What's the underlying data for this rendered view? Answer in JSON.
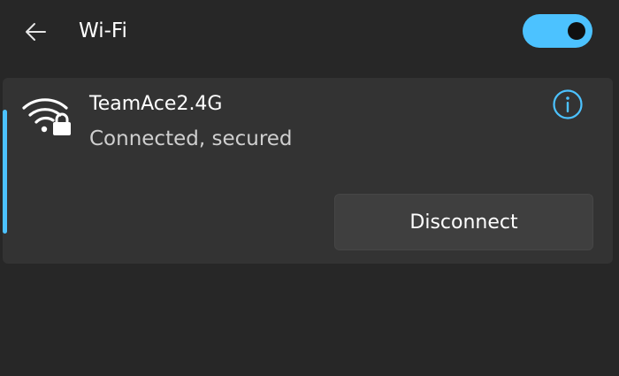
{
  "header": {
    "title": "Wi-Fi",
    "back_icon": "arrow-left-icon",
    "wifi_enabled": true,
    "toggle_color": "#4cc2ff"
  },
  "network": {
    "name": "TeamAce2.4G",
    "status": "Connected, secured",
    "icon": "wifi-secured-icon",
    "info_icon": "info-icon",
    "disconnect_label": "Disconnect",
    "accent_color": "#4cc2ff"
  }
}
